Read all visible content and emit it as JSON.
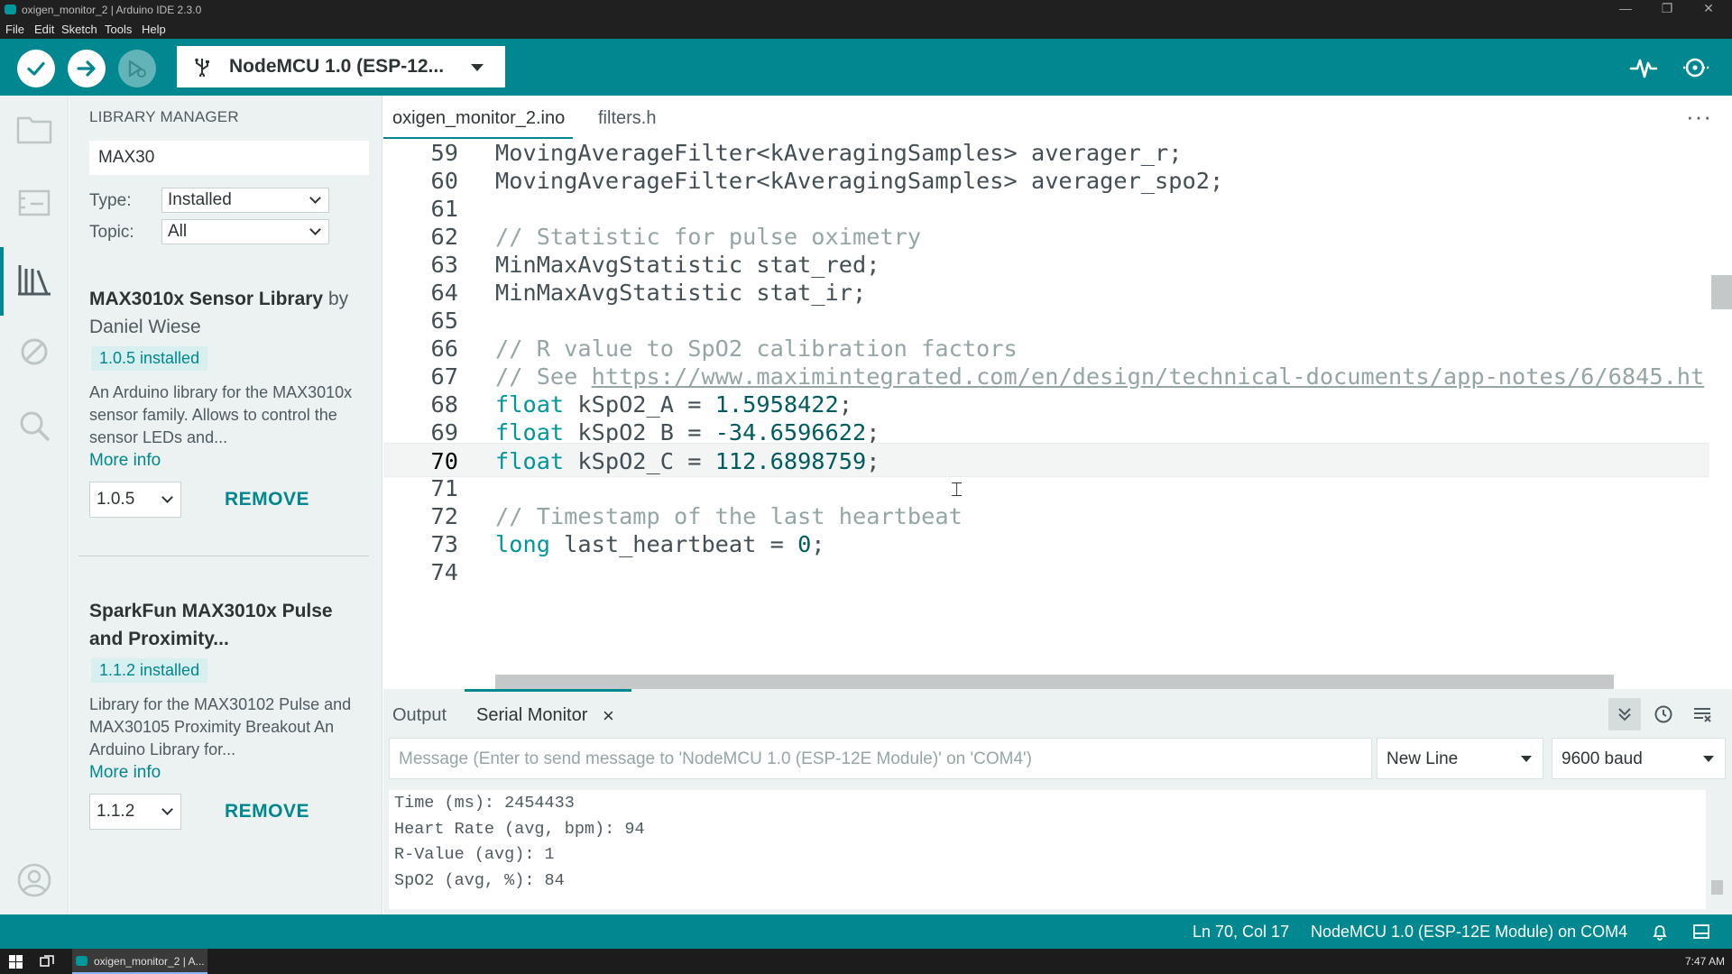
{
  "window": {
    "title": "oxigen_monitor_2 | Arduino IDE 2.3.0"
  },
  "menu": [
    "File",
    "Edit",
    "Sketch",
    "Tools",
    "Help"
  ],
  "toolbar": {
    "board": "NodeMCU 1.0 (ESP-12..."
  },
  "library_manager": {
    "title": "LIBRARY MANAGER",
    "search_value": "MAX30",
    "type_label": "Type:",
    "type_value": "Installed",
    "topic_label": "Topic:",
    "topic_value": "All",
    "items": [
      {
        "name": "MAX3010x Sensor Library",
        "by": "by Daniel Wiese",
        "badge": "1.0.5 installed",
        "desc": "An Arduino library for the MAX3010x sensor family. Allows to control the sensor LEDs and...",
        "more": "More info",
        "version": "1.0.5",
        "remove": "REMOVE"
      },
      {
        "name": "SparkFun MAX3010x Pulse and Proximity...",
        "by": "",
        "badge": "1.1.2 installed",
        "desc": "Library for the MAX30102 Pulse and MAX30105 Proximity Breakout An Arduino Library for...",
        "more": "More info",
        "version": "1.1.2",
        "remove": "REMOVE"
      }
    ]
  },
  "editor": {
    "tabs": [
      "oxigen_monitor_2.ino",
      "filters.h"
    ],
    "lines": [
      {
        "n": "59",
        "segs": [
          {
            "t": "MovingAverageFilter<kAveragingSamples> averager_r;",
            "c": ""
          }
        ]
      },
      {
        "n": "60",
        "segs": [
          {
            "t": "MovingAverageFilter<kAveragingSamples> averager_spo2;",
            "c": ""
          }
        ]
      },
      {
        "n": "61",
        "segs": []
      },
      {
        "n": "62",
        "segs": [
          {
            "t": "// Statistic for pulse oximetry",
            "c": "cm"
          }
        ]
      },
      {
        "n": "63",
        "segs": [
          {
            "t": "MinMaxAvgStatistic stat_red;",
            "c": ""
          }
        ]
      },
      {
        "n": "64",
        "segs": [
          {
            "t": "MinMaxAvgStatistic stat_ir;",
            "c": ""
          }
        ]
      },
      {
        "n": "65",
        "segs": []
      },
      {
        "n": "66",
        "segs": [
          {
            "t": "// R value to SpO2 calibration factors",
            "c": "cm"
          }
        ]
      },
      {
        "n": "67",
        "segs": [
          {
            "t": "// See ",
            "c": "cm"
          },
          {
            "t": "https://www.maximintegrated.com/en/design/technical-documents/app-notes/6/6845.ht",
            "c": "cm url"
          }
        ]
      },
      {
        "n": "68",
        "segs": [
          {
            "t": "float",
            "c": "kw"
          },
          {
            "t": " kSpO2_A = ",
            "c": ""
          },
          {
            "t": "1.5958422",
            "c": "num"
          },
          {
            "t": ";",
            "c": ""
          }
        ]
      },
      {
        "n": "69",
        "segs": [
          {
            "t": "float",
            "c": "kw"
          },
          {
            "t": " kSpO2_B = ",
            "c": ""
          },
          {
            "t": "-34.6596622",
            "c": "num"
          },
          {
            "t": ";",
            "c": ""
          }
        ]
      },
      {
        "n": "70",
        "segs": [
          {
            "t": "float",
            "c": "kw"
          },
          {
            "t": " kSpO2_C = ",
            "c": ""
          },
          {
            "t": "112.6898759",
            "c": "num"
          },
          {
            "t": ";",
            "c": ""
          }
        ],
        "current": true
      },
      {
        "n": "71",
        "segs": []
      },
      {
        "n": "72",
        "segs": [
          {
            "t": "// Timestamp of the last heartbeat",
            "c": "cm"
          }
        ]
      },
      {
        "n": "73",
        "segs": [
          {
            "t": "long",
            "c": "kw"
          },
          {
            "t": " last_heartbeat = ",
            "c": ""
          },
          {
            "t": "0",
            "c": "num"
          },
          {
            "t": ";",
            "c": ""
          }
        ]
      },
      {
        "n": "74",
        "segs": []
      }
    ]
  },
  "bottom_panel": {
    "tabs": [
      "Output",
      "Serial Monitor"
    ],
    "message_placeholder": "Message (Enter to send message to 'NodeMCU 1.0 (ESP-12E Module)' on 'COM4')",
    "line_ending": "New Line",
    "baud": "9600 baud",
    "serial_lines": [
      "Time (ms): 2454433",
      "Heart Rate (avg, bpm): 94",
      "R-Value (avg): 1",
      "SpO2 (avg, %): 84"
    ]
  },
  "status": {
    "position": "Ln 70, Col 17",
    "board_port": "NodeMCU 1.0 (ESP-12E Module) on COM4"
  },
  "taskbar": {
    "task_label": "oxigen_monitor_2 | A...",
    "clock": "7:47 AM"
  },
  "colors": {
    "accent": "#00878f",
    "keyword": "#00979c",
    "comment": "#95a5a6"
  }
}
